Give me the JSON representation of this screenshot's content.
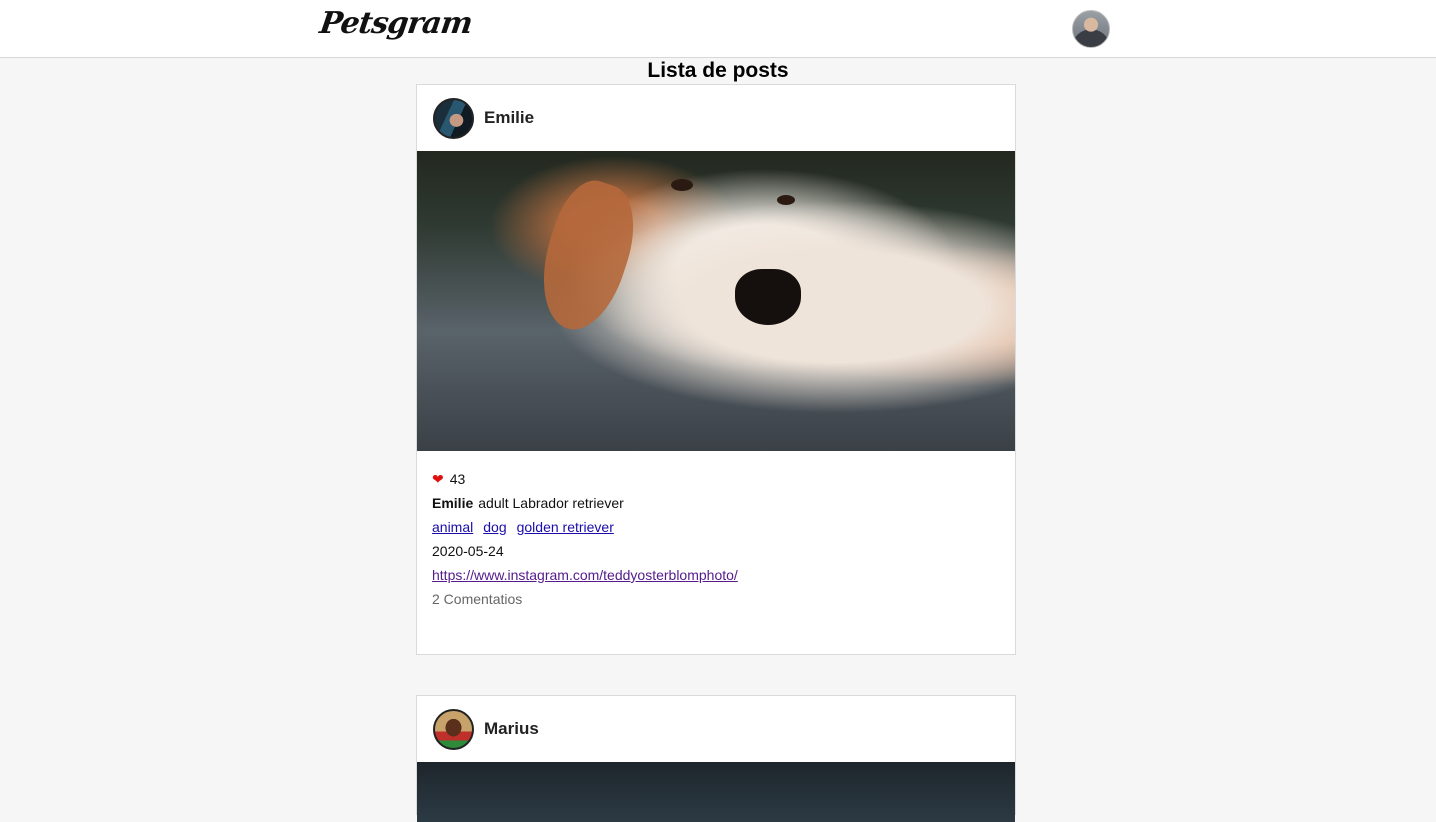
{
  "header": {
    "logo": "Petsgram"
  },
  "page_title": "Lista de posts",
  "posts": [
    {
      "username": "Emilie",
      "likes": "43",
      "caption_user": "Emilie",
      "caption": "adult Labrador retriever",
      "tags": [
        "animal",
        "dog",
        "golden retriever"
      ],
      "date": "2020-05-24",
      "source": "https://www.instagram.com/teddyosterblomphoto/",
      "comments": "2 Comentatios"
    },
    {
      "username": "Marius"
    }
  ]
}
